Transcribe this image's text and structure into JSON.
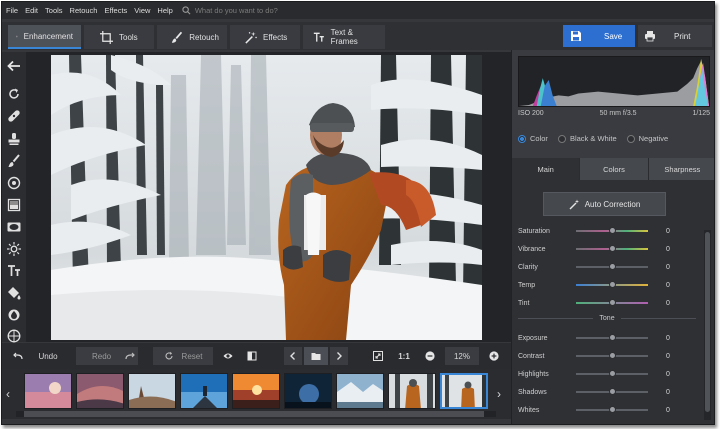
{
  "menu": [
    "File",
    "Edit",
    "Tools",
    "Retouch",
    "Effects",
    "View",
    "Help"
  ],
  "search": {
    "placeholder": "What do you want to do?"
  },
  "tabs": [
    {
      "label": "Enhancement",
      "icon": "sliders-icon"
    },
    {
      "label": "Tools",
      "icon": "crop-icon"
    },
    {
      "label": "Retouch",
      "icon": "brush-icon"
    },
    {
      "label": "Effects",
      "icon": "magic-wand-icon"
    },
    {
      "label": "Text & Frames",
      "icon": "text-icon"
    }
  ],
  "actions": {
    "save": "Save",
    "print": "Print"
  },
  "left_tools": [
    "back-arrow-icon",
    "rotate-icon",
    "bandage-icon",
    "stamp-icon",
    "brush-icon",
    "radial-filter-icon",
    "gradient-icon",
    "vignette-icon",
    "sun-icon",
    "text-icon",
    "fill-bucket-icon",
    "color-drop-icon",
    "globe-icon"
  ],
  "bottom": {
    "undo": "Undo",
    "redo": "Redo",
    "reset": "Reset",
    "one_to_one": "1:1",
    "zoom": "12%"
  },
  "histogram": {
    "iso": "ISO 200",
    "lens": "50 mm f/3.5",
    "shutter": "1/125"
  },
  "color_mode": {
    "options": [
      "Color",
      "Black & White",
      "Negative"
    ],
    "selected": "Color"
  },
  "panel_tabs": [
    "Main",
    "Colors",
    "Sharpness"
  ],
  "auto_correction": "Auto Correction",
  "sliders": [
    {
      "label": "Saturation",
      "value": "0"
    },
    {
      "label": "Vibrance",
      "value": "0"
    },
    {
      "label": "Clarity",
      "value": "0"
    },
    {
      "label": "Temp",
      "value": "0"
    },
    {
      "label": "Tint",
      "value": "0"
    }
  ],
  "tone_label": "Tone",
  "tone_sliders": [
    {
      "label": "Exposure",
      "value": "0"
    },
    {
      "label": "Contrast",
      "value": "0"
    },
    {
      "label": "Highlights",
      "value": "0"
    },
    {
      "label": "Shadows",
      "value": "0"
    },
    {
      "label": "Whites",
      "value": "0"
    }
  ],
  "colors": {
    "accent": "#2c6fd1",
    "toolbar": "#2f3034",
    "panel": "#393b40"
  }
}
